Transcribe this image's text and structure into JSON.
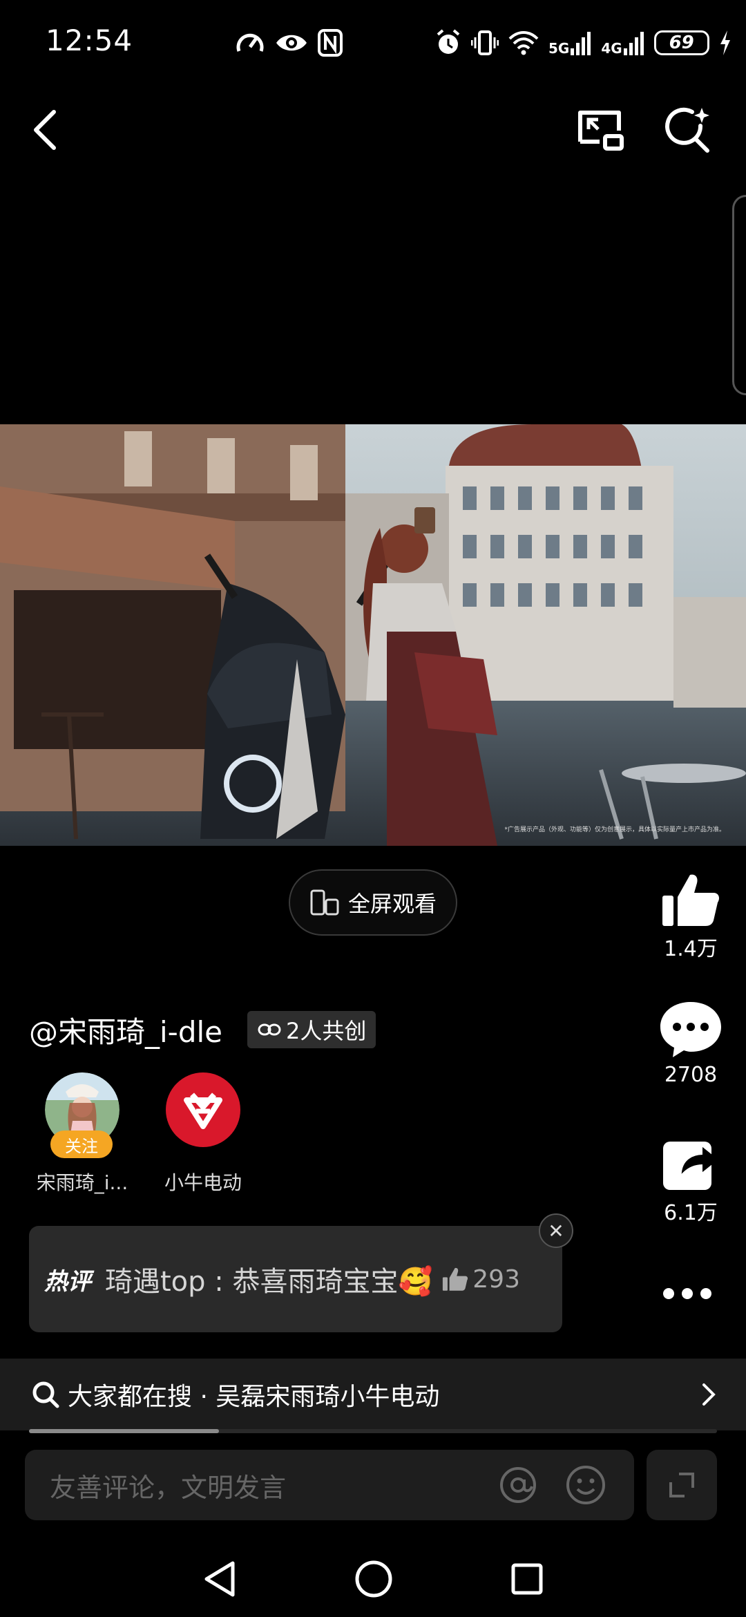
{
  "status_bar": {
    "time": "12:54",
    "battery": "69",
    "net1": "5G",
    "net2": "4G"
  },
  "video": {
    "disclaimer": "*广告展示产品（外观、功能等）仅为创意展示，具体以实际量产上市产品为准。"
  },
  "fullscreen": {
    "label": "全屏观看"
  },
  "side_actions": {
    "likes": "1.4万",
    "comments": "2708",
    "shares": "6.1万"
  },
  "author": {
    "handle": "@宋雨琦_i-dle",
    "cocreate": "2人共创"
  },
  "creators": [
    {
      "name": "宋雨琦_i...",
      "badge": "关注"
    },
    {
      "name": "小牛电动"
    }
  ],
  "hot_comment": {
    "tag": "热评",
    "text": "琦遇top : 恭喜雨琦宝宝🥰",
    "likes": "293"
  },
  "search": {
    "label": "大家都在搜 · 吴磊宋雨琦小牛电动"
  },
  "progress": {
    "fraction": 0.276
  },
  "comment_input": {
    "placeholder": "友善评论，文明发言"
  },
  "colors": {
    "accent_follow": "#f5a623",
    "niu_red": "#d9182b",
    "background": "#000000"
  }
}
